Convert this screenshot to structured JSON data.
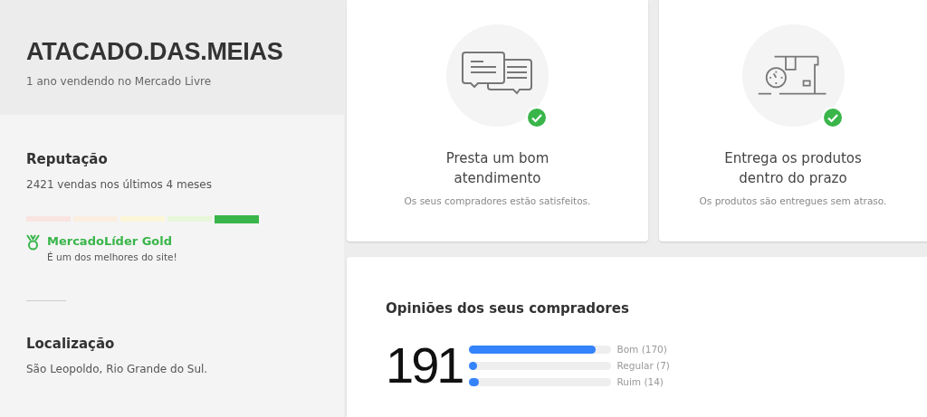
{
  "seller": {
    "name": "ATACADO.DAS.MEIAS",
    "since": "1 ano vendendo no Mercado Livre"
  },
  "reputation": {
    "title": "Reputação",
    "sales": "2421 vendas nos últimos 4 meses",
    "thermometer": [
      {
        "color": "#f9e4e1",
        "selected": false
      },
      {
        "color": "#fbeee0",
        "selected": false
      },
      {
        "color": "#fbf6d8",
        "selected": false
      },
      {
        "color": "#e8f6d9",
        "selected": false
      },
      {
        "color": "#39b54a",
        "selected": true
      }
    ],
    "badge": {
      "title": "MercadoLíder Gold",
      "subtitle": "É um dos melhores do site!"
    }
  },
  "location": {
    "title": "Localização",
    "text": "São Leopoldo, Rio Grande do Sul."
  },
  "cards": [
    {
      "kind": "chat",
      "title": "Presta um bom atendimento",
      "subtitle": "Os seus compradores estão satisfeitos.",
      "checked": true
    },
    {
      "kind": "delivery",
      "title": "Entrega os produtos dentro do prazo",
      "subtitle": "Os produtos são entregues sem atraso.",
      "checked": true
    }
  ],
  "opinions": {
    "title": "Opiniões dos seus compradores",
    "total": "191",
    "ratings": [
      {
        "label": "Bom (170)",
        "level": 0.89
      },
      {
        "label": "Regular (7)",
        "level": 0.04
      },
      {
        "label": "Ruim (14)",
        "level": 0.07
      }
    ]
  }
}
